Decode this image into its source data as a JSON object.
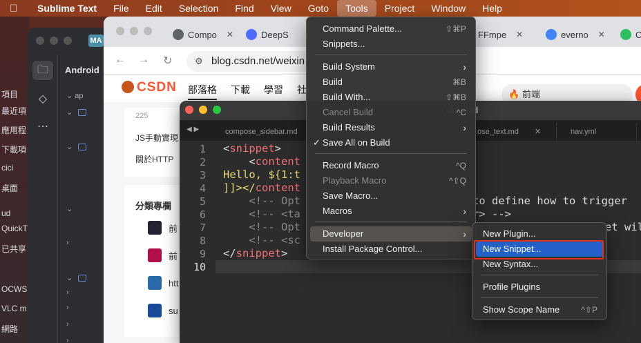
{
  "menubar": {
    "app_name": "Sublime Text",
    "items": [
      "File",
      "Edit",
      "Selection",
      "Find",
      "View",
      "Goto",
      "Tools",
      "Project",
      "Window",
      "Help"
    ],
    "active": "Tools"
  },
  "desktop_strip": [
    "項目",
    "最近項",
    "應用程",
    "下載項",
    "cici",
    "桌面",
    "ud",
    "QuickT",
    "已共享",
    "OCWS",
    "VLC m",
    "網路"
  ],
  "studio": {
    "badge": "MA",
    "panel_title": "Android",
    "tree_label": "ap"
  },
  "browser": {
    "tabs": [
      {
        "label": "Compo",
        "color": "#5f6368"
      },
      {
        "label": "DeepS",
        "color": "#4d6bfe"
      },
      {
        "label": "FFmpe",
        "color": "#333333"
      },
      {
        "label": "everno",
        "color": "#4285f4"
      },
      {
        "label": "C",
        "color": "#2dbe60"
      }
    ],
    "url": "blog.csdn.net/weixin",
    "csdn": {
      "logo": "CSDN",
      "nav": [
        "部落格",
        "下載",
        "學習",
        "社"
      ],
      "search_text": "前端",
      "count": "225",
      "line1": "JS手動實現",
      "line2": "關於HTTP",
      "section_title": "分類專欄",
      "categories": [
        "前",
        "前",
        "htt",
        "su"
      ]
    }
  },
  "sublime": {
    "title": "untitled",
    "tabs": [
      "compose_sidebar.md",
      "ose_text.md",
      "nav.yml"
    ],
    "line_numbers": [
      "1",
      "2",
      "3",
      "4",
      "5",
      "6",
      "7",
      "8",
      "9",
      "10"
    ],
    "code": {
      "l1_open": "<",
      "l1_tag": "snippet",
      "l1_close": ">",
      "l2_indent": "    ",
      "l2_open": "<",
      "l2_tag": "content",
      "l3_text": "Hello, ${1:t",
      "l4_pre": "]]></",
      "l4_tag": "content",
      "l5": "    <!-- Opt",
      "l5_tail": "to define how to trigger",
      "l6": "    <!-- <ta",
      "l6_tail": "r> -->",
      "l7": "    <!-- Opt",
      "l7_tail": "et wil",
      "l8": "    <!-- <sc",
      "l9_open": "</",
      "l9_tag": "snippet",
      "l9_close": ">"
    }
  },
  "tools_menu": {
    "items": [
      {
        "label": "Command Palette...",
        "shortcut": "⇧⌘P"
      },
      {
        "label": "Snippets..."
      },
      {
        "label": "Build System",
        "submenu": true
      },
      {
        "label": "Build",
        "shortcut": "⌘B"
      },
      {
        "label": "Build With...",
        "shortcut": "⇧⌘B"
      },
      {
        "label": "Cancel Build",
        "shortcut": "^C",
        "disabled": true
      },
      {
        "label": "Build Results",
        "submenu": true
      },
      {
        "label": "Save All on Build",
        "checked": true
      },
      {
        "label": "Record Macro",
        "shortcut": "^Q"
      },
      {
        "label": "Playback Macro",
        "shortcut": "^⇧Q",
        "disabled": true
      },
      {
        "label": "Save Macro..."
      },
      {
        "label": "Macros",
        "submenu": true
      },
      {
        "label": "Developer",
        "submenu": true,
        "highlighted": true
      },
      {
        "label": "Install Package Control..."
      }
    ]
  },
  "developer_menu": {
    "items": [
      {
        "label": "New Plugin..."
      },
      {
        "label": "New Snippet...",
        "selected": true
      },
      {
        "label": "New Syntax..."
      },
      {
        "label": "Profile Plugins"
      },
      {
        "label": "Show Scope Name",
        "shortcut": "^⇧P"
      }
    ]
  },
  "colors": {
    "selection": "#2360c8",
    "annotation_box": "#e0301e",
    "csdn_brand": "#fc5531"
  }
}
